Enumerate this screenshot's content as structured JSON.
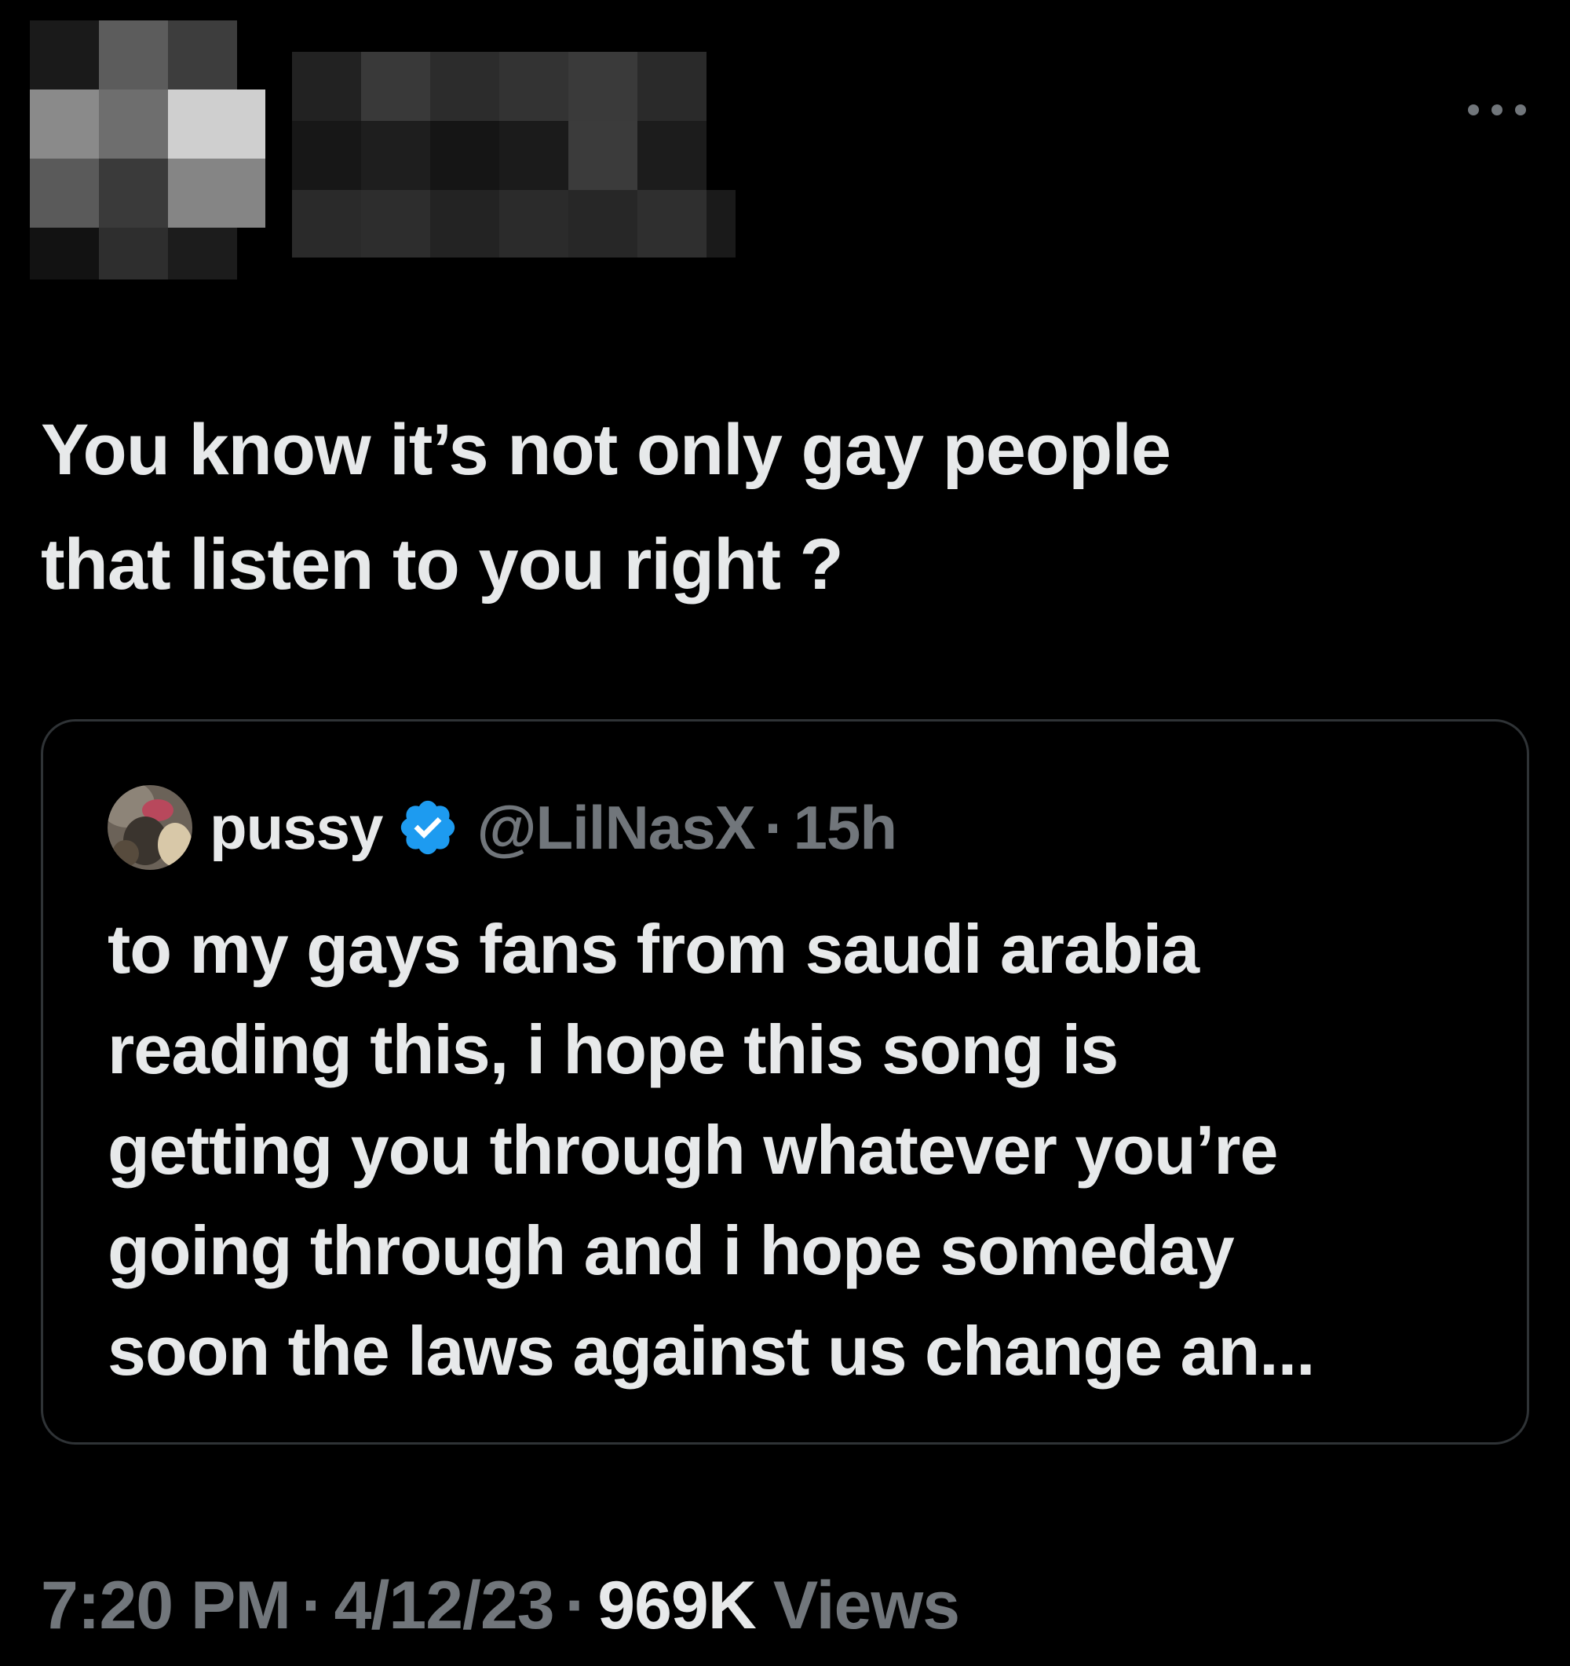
{
  "colors": {
    "background": "#000000",
    "text_primary": "#e7e9ea",
    "text_secondary": "#71767b",
    "card_border": "#2f3336",
    "verified_blue": "#1d9bf0"
  },
  "header": {
    "author_avatar": "pixelated-avatar",
    "author_name": "pixelated-name",
    "more_icon": "more-horizontal-icon"
  },
  "tweet": {
    "text_line1": "You know it’s not only gay people",
    "text_line2": "that listen to you right ?"
  },
  "quote": {
    "avatar": "avatar-image",
    "display_name": "pussy",
    "verified_icon": "verified-badge-icon",
    "handle": "@LilNasX",
    "separator": "·",
    "time": "15h",
    "lines": [
      "to my gays fans from saudi arabia",
      "reading this, i hope this song is",
      "getting you through whatever you’re",
      "going through and i hope someday",
      "soon the laws against us change an..."
    ]
  },
  "meta": {
    "time": "7:20 PM",
    "separator": "·",
    "date": "4/12/23",
    "views_count": "969K",
    "views_label": "Views"
  }
}
